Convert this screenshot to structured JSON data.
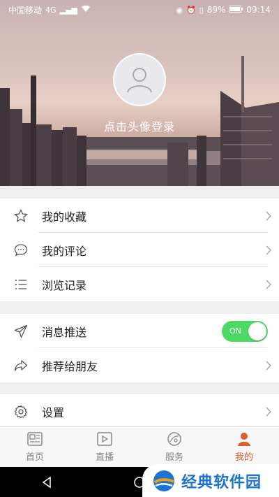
{
  "status_bar": {
    "carrier": "中国移动",
    "network": "4G",
    "battery": "89%",
    "time": "09:14"
  },
  "profile": {
    "login_prompt": "点击头像登录"
  },
  "menu_group_1": [
    {
      "label": "我的收藏",
      "icon": "star-icon"
    },
    {
      "label": "我的评论",
      "icon": "comment-icon"
    },
    {
      "label": "浏览记录",
      "icon": "list-icon"
    }
  ],
  "menu_group_2": [
    {
      "label": "消息推送",
      "icon": "send-icon",
      "toggle": true,
      "toggle_text": "ON"
    },
    {
      "label": "推荐给朋友",
      "icon": "share-icon"
    }
  ],
  "menu_group_3": [
    {
      "label": "设置",
      "icon": "gear-icon"
    }
  ],
  "tabs": [
    {
      "label": "首页",
      "icon": "news-icon"
    },
    {
      "label": "直播",
      "icon": "live-video-icon"
    },
    {
      "label": "服务",
      "icon": "service-icon"
    },
    {
      "label": "我的",
      "icon": "user-icon",
      "active": true
    }
  ],
  "colors": {
    "accent": "#e05a2a",
    "toggle_on": "#4cd964"
  },
  "watermark": {
    "text": "经典软件园"
  }
}
